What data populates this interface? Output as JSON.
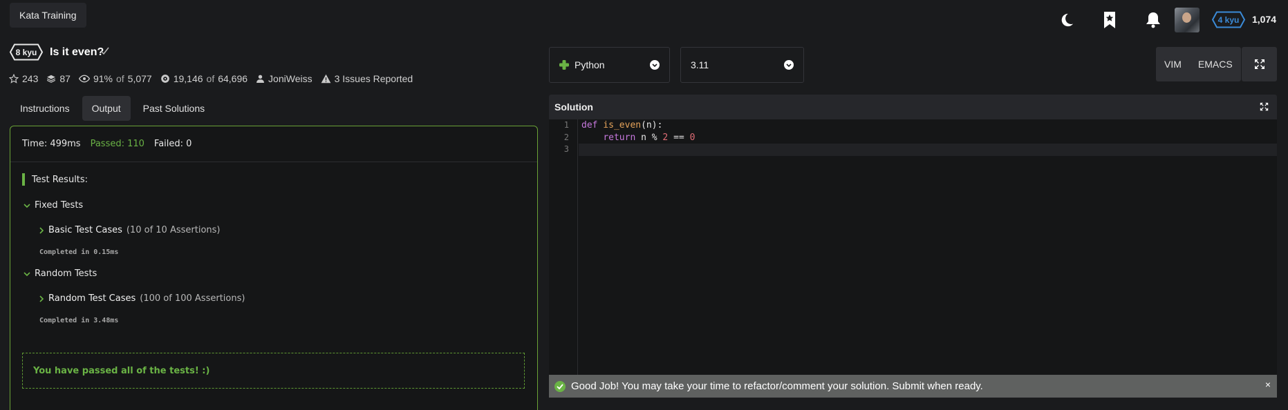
{
  "breadcrumb": "Kata Training",
  "user": {
    "rank": "4 kyu",
    "honor": "1,074"
  },
  "kata": {
    "rank": "8 kyu",
    "title": "Is it even?",
    "stars": "243",
    "collections": "87",
    "satisfaction_pct": "91%",
    "satisfaction_of": "of",
    "satisfaction_votes": "5,077",
    "completed": "19,146",
    "completed_of": "of",
    "attempts": "64,696",
    "author": "JoniWeiss",
    "issues": "3 Issues Reported"
  },
  "tabs": [
    "Instructions",
    "Output",
    "Past Solutions"
  ],
  "output": {
    "time": "Time: 499ms",
    "passed": "Passed: 110",
    "failed": "Failed: 0",
    "results_label": "Test Results:",
    "groups": [
      {
        "name": "Fixed Tests",
        "case": "Basic Test Cases",
        "assertions": "(10 of 10 Assertions)",
        "completed": "Completed in 0.15ms"
      },
      {
        "name": "Random Tests",
        "case": "Random Test Cases",
        "assertions": "(100 of 100 Assertions)",
        "completed": "Completed in 3.48ms"
      }
    ],
    "pass_message": "You have passed all of the tests! :)"
  },
  "language": {
    "selected": "Python",
    "version": "3.11"
  },
  "editor_modes": [
    "VIM",
    "EMACS"
  ],
  "editor": {
    "title": "Solution",
    "line_numbers": [
      "1",
      "2",
      "3"
    ],
    "code": {
      "l1_kw": "def",
      "l1_fn": "is_even",
      "l1_rest": "(n):",
      "l2_indent": "    ",
      "l2_kw": "return",
      "l2_mid": " n % ",
      "l2_num1": "2",
      "l2_eq": " == ",
      "l2_num2": "0"
    }
  },
  "toast": {
    "message": "Good Job! You may take your time to refactor/comment your solution. Submit when ready.",
    "close": "×"
  },
  "colors": {
    "accent_green": "#6ab345",
    "rank_blue": "#3b8bd8",
    "background": "#1a1b1d"
  }
}
